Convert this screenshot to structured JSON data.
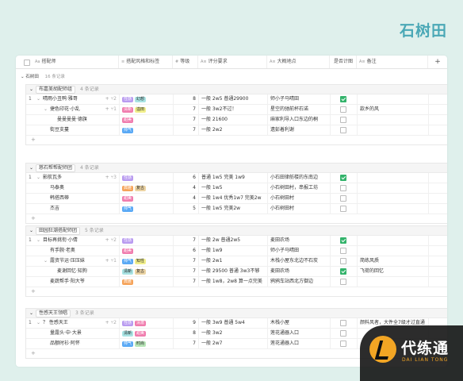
{
  "brand": "石树田",
  "columns": [
    {
      "icon": "Aa",
      "label": "搭配师"
    },
    {
      "icon": "≡",
      "label": "搭配风格和标签"
    },
    {
      "icon": "#",
      "label": "等级"
    },
    {
      "icon": "A≡",
      "label": "评分要求"
    },
    {
      "icon": "A≡",
      "label": "大概地点"
    },
    {
      "icon": "",
      "label": "是否计图"
    },
    {
      "icon": "A≡",
      "label": "备注"
    }
  ],
  "top_group": {
    "label": "石树田",
    "count": "16 条记录"
  },
  "groups": [
    {
      "label": "布嘉美胡配师组",
      "count": "4 条记录",
      "rows": [
        {
          "idx": "1",
          "name": "晴雨小丑鸭·雅哥",
          "indent": 0,
          "expand": "⌄",
          "sub": "2",
          "tags": [
            {
              "t": "性感",
              "c": "purple"
            },
            {
              "t": "幻想",
              "c": "teal"
            }
          ],
          "level": "8",
          "score": "一般 2w5 普通29900",
          "place": "师小子马晴田",
          "check": true,
          "note": ""
        },
        {
          "idx": "",
          "name": "捷色印花·小乱",
          "indent": 1,
          "expand": "⌄",
          "sub": "1",
          "tags": [
            {
              "t": "清新",
              "c": "pink"
            },
            {
              "t": "溢田",
              "c": "yellow"
            }
          ],
          "level": "7",
          "score": "一般 3w2不过！",
          "place": "星空的驰前杯石诺",
          "check": false,
          "note": "款乡的风"
        },
        {
          "idx": "",
          "name": "曼曼曼曼·德旗",
          "indent": 2,
          "expand": "",
          "sub": "",
          "tags": [
            {
              "t": "甜美",
              "c": "pink"
            }
          ],
          "level": "7",
          "score": "一般 21600",
          "place": "麻家利导入口东边的桐",
          "check": false,
          "note": ""
        },
        {
          "idx": "",
          "name": "街豆支蔓",
          "indent": 1,
          "expand": "",
          "sub": "",
          "tags": [
            {
              "t": "帅气",
              "c": "blue"
            }
          ],
          "level": "7",
          "score": "一般 2w2",
          "place": "遗彭着利谢",
          "check": false,
          "note": ""
        }
      ]
    },
    {
      "label": "慈石帮帮配师团",
      "count": "4 条记录",
      "rows": [
        {
          "idx": "1",
          "name": "影航瓦多",
          "indent": 0,
          "expand": "⌄",
          "sub": "3",
          "tags": [
            {
              "t": "性感",
              "c": "purple"
            }
          ],
          "level": "6",
          "score": "普通 1w5 完美 1w9",
          "place": "小石田律舫楼的东南边",
          "check": true,
          "note": ""
        },
        {
          "idx": "",
          "name": "马泰奥",
          "indent": 1,
          "expand": "",
          "sub": "",
          "tags": [
            {
              "t": "典雅",
              "c": "orange"
            },
            {
              "t": "复古",
              "c": "tan"
            }
          ],
          "level": "4",
          "score": "一般 1w5",
          "place": "小石树田村，串报工坊",
          "check": false,
          "note": ""
        },
        {
          "idx": "",
          "name": "韩搭西蒂",
          "indent": 1,
          "expand": "",
          "sub": "",
          "tags": [
            {
              "t": "甜美",
              "c": "pink"
            }
          ],
          "level": "4",
          "score": "一般 1w4 优秀1w7 完美2w",
          "place": "小石树田村",
          "check": false,
          "note": ""
        },
        {
          "idx": "",
          "name": "杰吉",
          "indent": 1,
          "expand": "",
          "sub": "",
          "tags": [
            {
              "t": "帅气",
              "c": "blue"
            }
          ],
          "level": "5",
          "score": "一般 1w5 完美2w",
          "place": "小石树田村",
          "check": false,
          "note": ""
        }
      ]
    },
    {
      "label": "田园狂潮搭配师团",
      "count": "5 条记录",
      "rows": [
        {
          "idx": "1",
          "name": "目标再挑衔·小倩",
          "indent": 0,
          "expand": "⌄",
          "sub": "2",
          "tags": [
            {
              "t": "性感",
              "c": "purple"
            }
          ],
          "level": "7",
          "score": "一般 2w 普通2w5",
          "place": "麦田农场",
          "check": true,
          "note": ""
        },
        {
          "idx": "",
          "name": "有手腕·老奥",
          "indent": 1,
          "expand": "",
          "sub": "",
          "tags": [
            {
              "t": "甜美",
              "c": "pink"
            }
          ],
          "level": "6",
          "score": "一般 1w9",
          "place": "师小子马晴田",
          "check": false,
          "note": ""
        },
        {
          "idx": "",
          "name": "露资节运·压压妹",
          "indent": 1,
          "expand": "⌄",
          "sub": "1",
          "tags": [
            {
              "t": "帅气",
              "c": "blue"
            },
            {
              "t": "知性",
              "c": "yellow"
            }
          ],
          "level": "7",
          "score": "一般 2w1",
          "place": "木栈小屋东北边不石炭",
          "check": false,
          "note": "简练风质"
        },
        {
          "idx": "",
          "name": "麦谢回忆·知狗",
          "indent": 2,
          "expand": "",
          "sub": "",
          "tags": [
            {
              "t": "清新",
              "c": "teal"
            },
            {
              "t": "复古",
              "c": "tan"
            }
          ],
          "level": "7",
          "score": "一般 29500 普通 3w3不够",
          "place": "麦田农场",
          "check": true,
          "note": "飞荷的回忆"
        },
        {
          "idx": "",
          "name": "麦蔬帮手·阳大爷",
          "indent": 1,
          "expand": "",
          "sub": "",
          "tags": [
            {
              "t": "典雅",
              "c": "orange"
            }
          ],
          "level": "7",
          "score": "一般 1w8，2w8 算一点完美",
          "place": "鸦鸦车站西北方御边",
          "check": false,
          "note": ""
        }
      ]
    },
    {
      "label": "性感天王领唱",
      "count": "3 条记录",
      "rows": [
        {
          "idx": "1",
          "name": "？ 性感天王",
          "indent": 0,
          "expand": "⌄",
          "sub": "2",
          "tags": [
            {
              "t": "性感",
              "c": "purple"
            },
            {
              "t": "清澈",
              "c": "pink"
            }
          ],
          "level": "9",
          "score": "一般 3w9 普通 5w4",
          "place": "木栈小屋",
          "check": false,
          "note": "颜料风者，大件全7级才过直通"
        },
        {
          "idx": "",
          "name": "量露头·中·大景",
          "indent": 1,
          "expand": "",
          "sub": "",
          "tags": [
            {
              "t": "清新",
              "c": "teal"
            },
            {
              "t": "甜美",
              "c": "pink"
            }
          ],
          "level": "8",
          "score": "一般 3w2",
          "place": "莲花通器入口",
          "check": false,
          "note": ""
        },
        {
          "idx": "",
          "name": "品额时衫·阿怀",
          "indent": 1,
          "expand": "",
          "sub": "",
          "tags": [
            {
              "t": "帅气",
              "c": "blue"
            },
            {
              "t": "时尚",
              "c": "green"
            }
          ],
          "level": "7",
          "score": "一般 2w7",
          "place": "莲花通器入口",
          "check": false,
          "note": ""
        }
      ]
    }
  ],
  "watermark": {
    "title": "代练通",
    "subtitle": "DAI LIAN TONG"
  }
}
